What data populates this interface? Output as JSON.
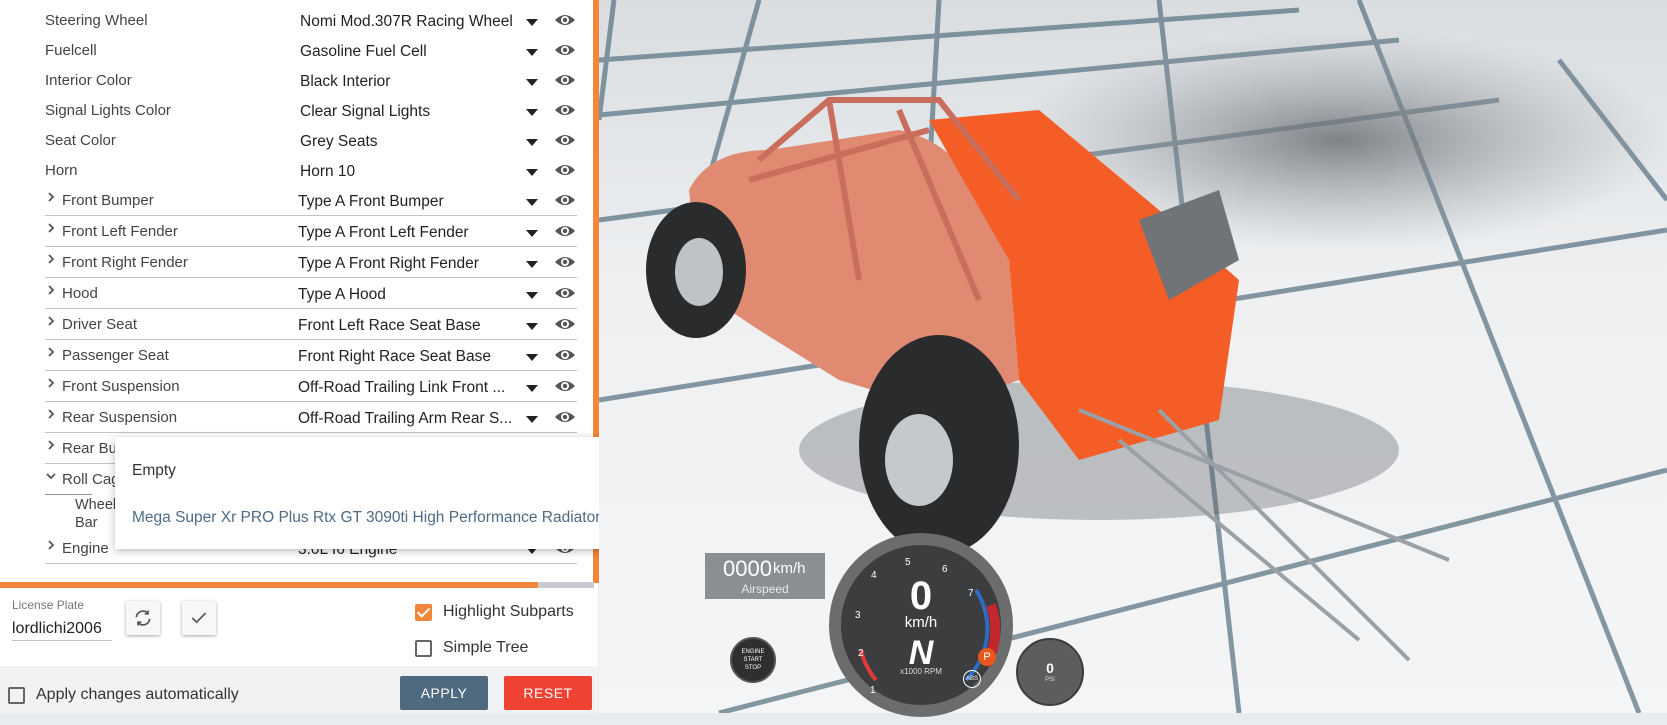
{
  "parts": [
    {
      "label": "Steering Wheel",
      "value": "Nomi Mod.307R Racing Wheel",
      "expandable": false
    },
    {
      "label": "Fuelcell",
      "value": "Gasoline Fuel Cell",
      "expandable": false
    },
    {
      "label": "Interior Color",
      "value": "Black Interior",
      "expandable": false
    },
    {
      "label": "Signal Lights Color",
      "value": "Clear Signal Lights",
      "expandable": false
    },
    {
      "label": "Seat Color",
      "value": "Grey Seats",
      "expandable": false
    },
    {
      "label": "Horn",
      "value": "Horn 10",
      "expandable": false
    },
    {
      "label": "Front Bumper",
      "value": "Type A Front Bumper",
      "expandable": true
    },
    {
      "label": "Front Left Fender",
      "value": "Type A Front Left Fender",
      "expandable": true
    },
    {
      "label": "Front Right Fender",
      "value": "Type A Front Right Fender",
      "expandable": true
    },
    {
      "label": "Hood",
      "value": "Type A Hood",
      "expandable": true
    },
    {
      "label": "Driver Seat",
      "value": "Front Left Race Seat Base",
      "expandable": true
    },
    {
      "label": "Passenger Seat",
      "value": "Front Right Race Seat Base",
      "expandable": true
    },
    {
      "label": "Front Suspension",
      "value": "Off-Road Trailing Link Front ...",
      "expandable": true
    },
    {
      "label": "Rear Suspension",
      "value": "Off-Road Trailing Arm Rear S...",
      "expandable": true
    },
    {
      "label": "Rear Bu",
      "value": "",
      "expandable": true
    },
    {
      "label": "Roll Cag",
      "value": "",
      "expandable": true,
      "expanded": true
    },
    {
      "label": "Wheel Bar",
      "value": "",
      "expandable": false,
      "sub": true
    },
    {
      "label": "Engine",
      "value": "3.0L I6 Engine",
      "expandable": true
    }
  ],
  "dropdown": {
    "options": [
      "Empty",
      "Mega Super Xr PRO Plus Rtx GT 3090ti High Performance Radiator"
    ]
  },
  "license": {
    "caption": "License Plate",
    "value": "lordlichi2006"
  },
  "options": {
    "highlight_subparts": "Highlight Subparts",
    "simple_tree": "Simple Tree",
    "highlight_checked": true,
    "simple_checked": false
  },
  "footer": {
    "apply_auto": "Apply changes automatically",
    "apply": "APPLY",
    "reset": "RESET"
  },
  "hud": {
    "airspeed_value": "0000",
    "airspeed_unit": "km/h",
    "airspeed_label": "Airspeed",
    "speed": "0",
    "speed_unit": "km/h",
    "gear": "N",
    "rpm_label": "x1000 RPM",
    "ticks": [
      "1",
      "2",
      "3",
      "4",
      "5",
      "6",
      "7"
    ],
    "engine_btn": [
      "ENGINE",
      "START",
      "STOP"
    ],
    "psi_value": "0",
    "psi_unit": "PSI",
    "abs": "ABS",
    "park": "P"
  },
  "colors": {
    "accent": "#f0873b",
    "apply": "#4f6a7e",
    "reset": "#ef4233",
    "link": "#4f6a86"
  }
}
